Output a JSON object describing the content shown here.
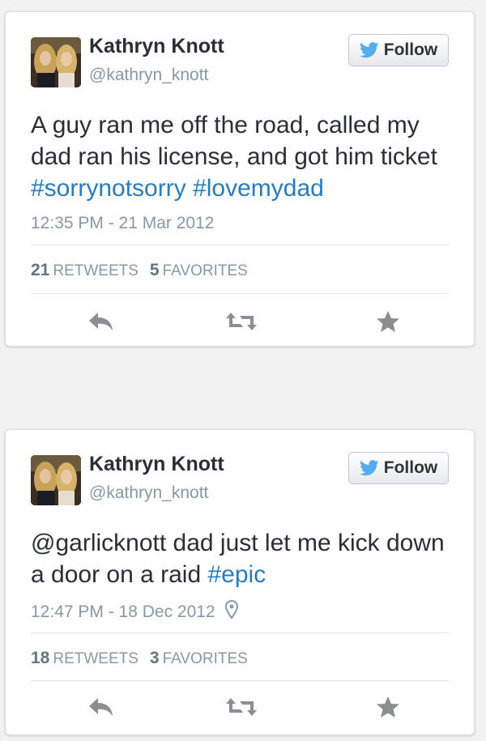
{
  "colors": {
    "hashtag": "#2b7bb9",
    "name": "#292f33",
    "secondary": "#8899a6",
    "bird": "#55acee",
    "action_icon": "#8b8f94"
  },
  "tweets": [
    {
      "author": {
        "name": "Kathryn Knott",
        "handle": "@kathryn_knott"
      },
      "follow_label": "Follow",
      "text": {
        "plain": "A guy ran me off the road, called my dad ran his license, and got him ticket ",
        "hashtag1": "#sorrynotsorry",
        "space": " ",
        "hashtag2": "#lovemydad"
      },
      "timestamp": "12:35 PM - 21 Mar 2012",
      "has_location": false,
      "retweets": "21",
      "retweets_label": "RETWEETS",
      "favorites": "5",
      "favorites_label": "FAVORITES",
      "icons": {
        "reply": "reply-icon",
        "retweet": "retweet-icon",
        "favorite": "star-icon"
      }
    },
    {
      "author": {
        "name": "Kathryn Knott",
        "handle": "@kathryn_knott"
      },
      "follow_label": "Follow",
      "text": {
        "mention": "@garlicknott",
        "plain": " dad just let me kick down a door on a raid ",
        "hashtag1": "#epic"
      },
      "timestamp": "12:47 PM - 18 Dec 2012",
      "has_location": true,
      "retweets": "18",
      "retweets_label": "RETWEETS",
      "favorites": "3",
      "favorites_label": "FAVORITES",
      "icons": {
        "reply": "reply-icon",
        "retweet": "retweet-icon",
        "favorite": "star-icon",
        "location": "location-pin-icon"
      }
    }
  ]
}
